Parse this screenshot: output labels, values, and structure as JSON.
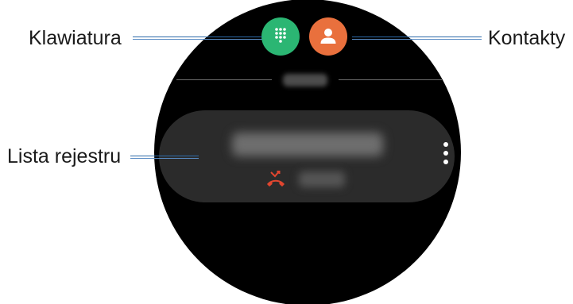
{
  "callouts": {
    "keypad": "Klawiatura",
    "contacts": "Kontakty",
    "call_log": "Lista rejestru"
  },
  "buttons": {
    "keypad_icon": "dialpad-icon",
    "contacts_icon": "person-icon",
    "keypad_color": "#2bb673",
    "contacts_color": "#e9703d"
  },
  "log_entry": {
    "status_icon": "missed-call-icon",
    "status_color": "#e0462f",
    "menu_icon": "more-vertical-icon"
  }
}
